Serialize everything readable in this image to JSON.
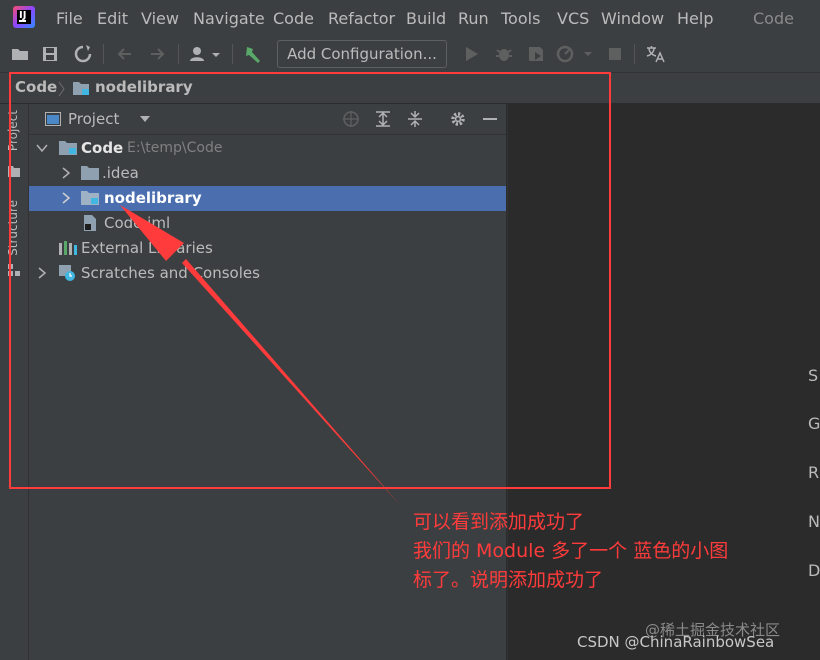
{
  "menubar": {
    "items": [
      "File",
      "Edit",
      "View",
      "Navigate",
      "Code",
      "Refactor",
      "Build",
      "Run",
      "Tools",
      "VCS",
      "Window",
      "Help"
    ],
    "project_name": "Code"
  },
  "toolbar": {
    "add_configuration_label": "Add Configuration..."
  },
  "breadcrumb": {
    "items": [
      "Code",
      "nodelibrary"
    ]
  },
  "left_strip": {
    "tabs": [
      "Project",
      "Structure"
    ]
  },
  "project_panel": {
    "title": "Project",
    "tree": [
      {
        "label": "Code",
        "path": "E:\\temp\\Code",
        "expanded": true
      },
      {
        "label": ".idea",
        "expanded": false
      },
      {
        "label": "nodelibrary",
        "expanded": false,
        "selected": true
      },
      {
        "label": "Code.iml"
      },
      {
        "label": "External Libraries"
      },
      {
        "label": "Scratches and Consoles",
        "expanded": false
      }
    ]
  },
  "right_edge_letters": [
    "S",
    "G",
    "R",
    "N",
    "D"
  ],
  "annotation": {
    "lines": [
      "可以看到添加成功了",
      "我们的 Module 多了一个 蓝色的小图",
      "标了。说明添加成功了"
    ],
    "color": "#ff3b3b"
  },
  "watermark": {
    "line1": "@稀土掘金技术社区",
    "line2": "CSDN @ChinaRainbowSea"
  },
  "colors": {
    "selection": "#4b6eaf",
    "panel_bg": "#3c3f41",
    "editor_bg": "#2b2b2b"
  }
}
